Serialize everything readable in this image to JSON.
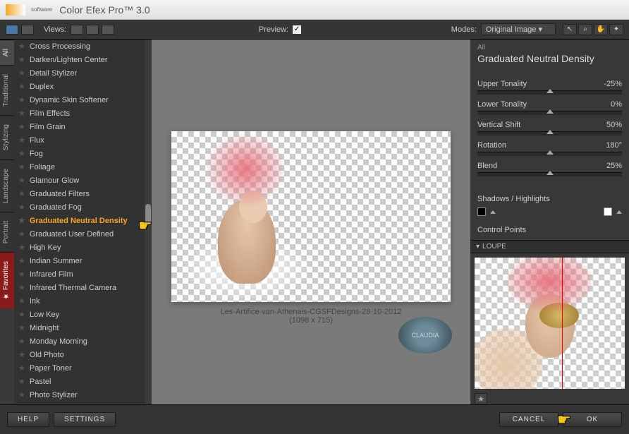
{
  "app": {
    "title": "Color Efex Pro™ 3.0"
  },
  "toolbar": {
    "views_label": "Views:",
    "preview_label": "Preview:",
    "modes_label": "Modes:",
    "mode_value": "Original Image"
  },
  "vtabs": [
    "All",
    "Traditional",
    "Stylizing",
    "Landscape",
    "Portrait",
    "Favorites"
  ],
  "filters": [
    "Cross Processing",
    "Darken/Lighten Center",
    "Detail Stylizer",
    "Duplex",
    "Dynamic Skin Softener",
    "Film Effects",
    "Film Grain",
    "Flux",
    "Fog",
    "Foliage",
    "Glamour Glow",
    "Graduated Filters",
    "Graduated Fog",
    "Graduated Neutral Density",
    "Graduated User Defined",
    "High Key",
    "Indian Summer",
    "Infrared Film",
    "Infrared Thermal Camera",
    "Ink",
    "Low Key",
    "Midnight",
    "Monday Morning",
    "Old Photo",
    "Paper Toner",
    "Pastel",
    "Photo Stylizer"
  ],
  "selected_filter": "Graduated Neutral Density",
  "preview": {
    "filename": "Les-Artifice-van-Athenais-CGSFDesigns-28-10-2012",
    "dimensions": "(1098 x 715)",
    "watermark": "CLAUDIA"
  },
  "panel": {
    "category": "All",
    "title": "Graduated Neutral Density",
    "sliders": [
      {
        "label": "Upper Tonality",
        "value": "-25%"
      },
      {
        "label": "Lower Tonality",
        "value": "0%"
      },
      {
        "label": "Vertical Shift",
        "value": "50%"
      },
      {
        "label": "Rotation",
        "value": "180°"
      },
      {
        "label": "Blend",
        "value": "25%"
      }
    ],
    "shadows_label": "Shadows / Highlights",
    "control_points_label": "Control Points",
    "loupe_label": "LOUPE"
  },
  "buttons": {
    "help": "HELP",
    "settings": "SETTINGS",
    "cancel": "CANCEL",
    "ok": "OK"
  }
}
